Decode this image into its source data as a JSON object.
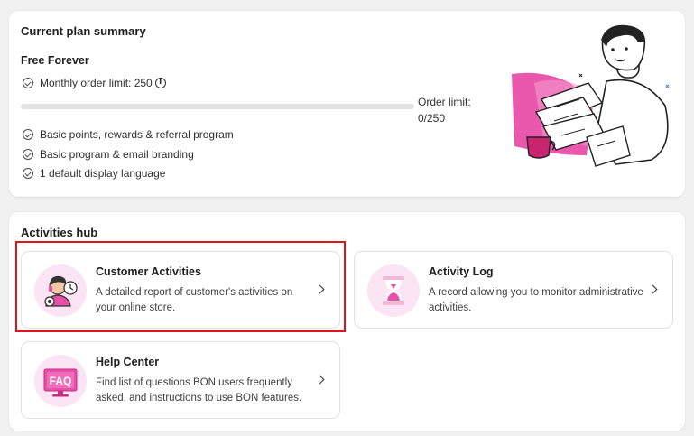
{
  "plan": {
    "title": "Current plan summary",
    "name": "Free Forever",
    "monthly_limit_label": "Monthly order limit: 250",
    "info_glyph": "i",
    "order_limit_label": "Order limit:",
    "order_limit_value": "0/250",
    "usage_fraction": 0,
    "features": [
      "Basic points, rewards & referral program",
      "Basic program & email branding",
      "1 default display language"
    ]
  },
  "hub": {
    "title": "Activities hub",
    "tiles": [
      {
        "title": "Customer Activities",
        "desc": "A detailed report of customer's activities on your online store.",
        "icon": "customer-activities-icon"
      },
      {
        "title": "Activity Log",
        "desc": "A record allowing you to monitor administrative activities.",
        "icon": "hourglass-icon"
      },
      {
        "title": "Help Center",
        "desc": "Find list of questions BON users frequently asked, and instructions to use BON features.",
        "icon": "faq-icon"
      }
    ]
  },
  "colors": {
    "accent_pink": "#e84fa8",
    "icon_bg": "#fbe4f3",
    "highlight": "#e1141b",
    "progress_fill": "#616161"
  }
}
